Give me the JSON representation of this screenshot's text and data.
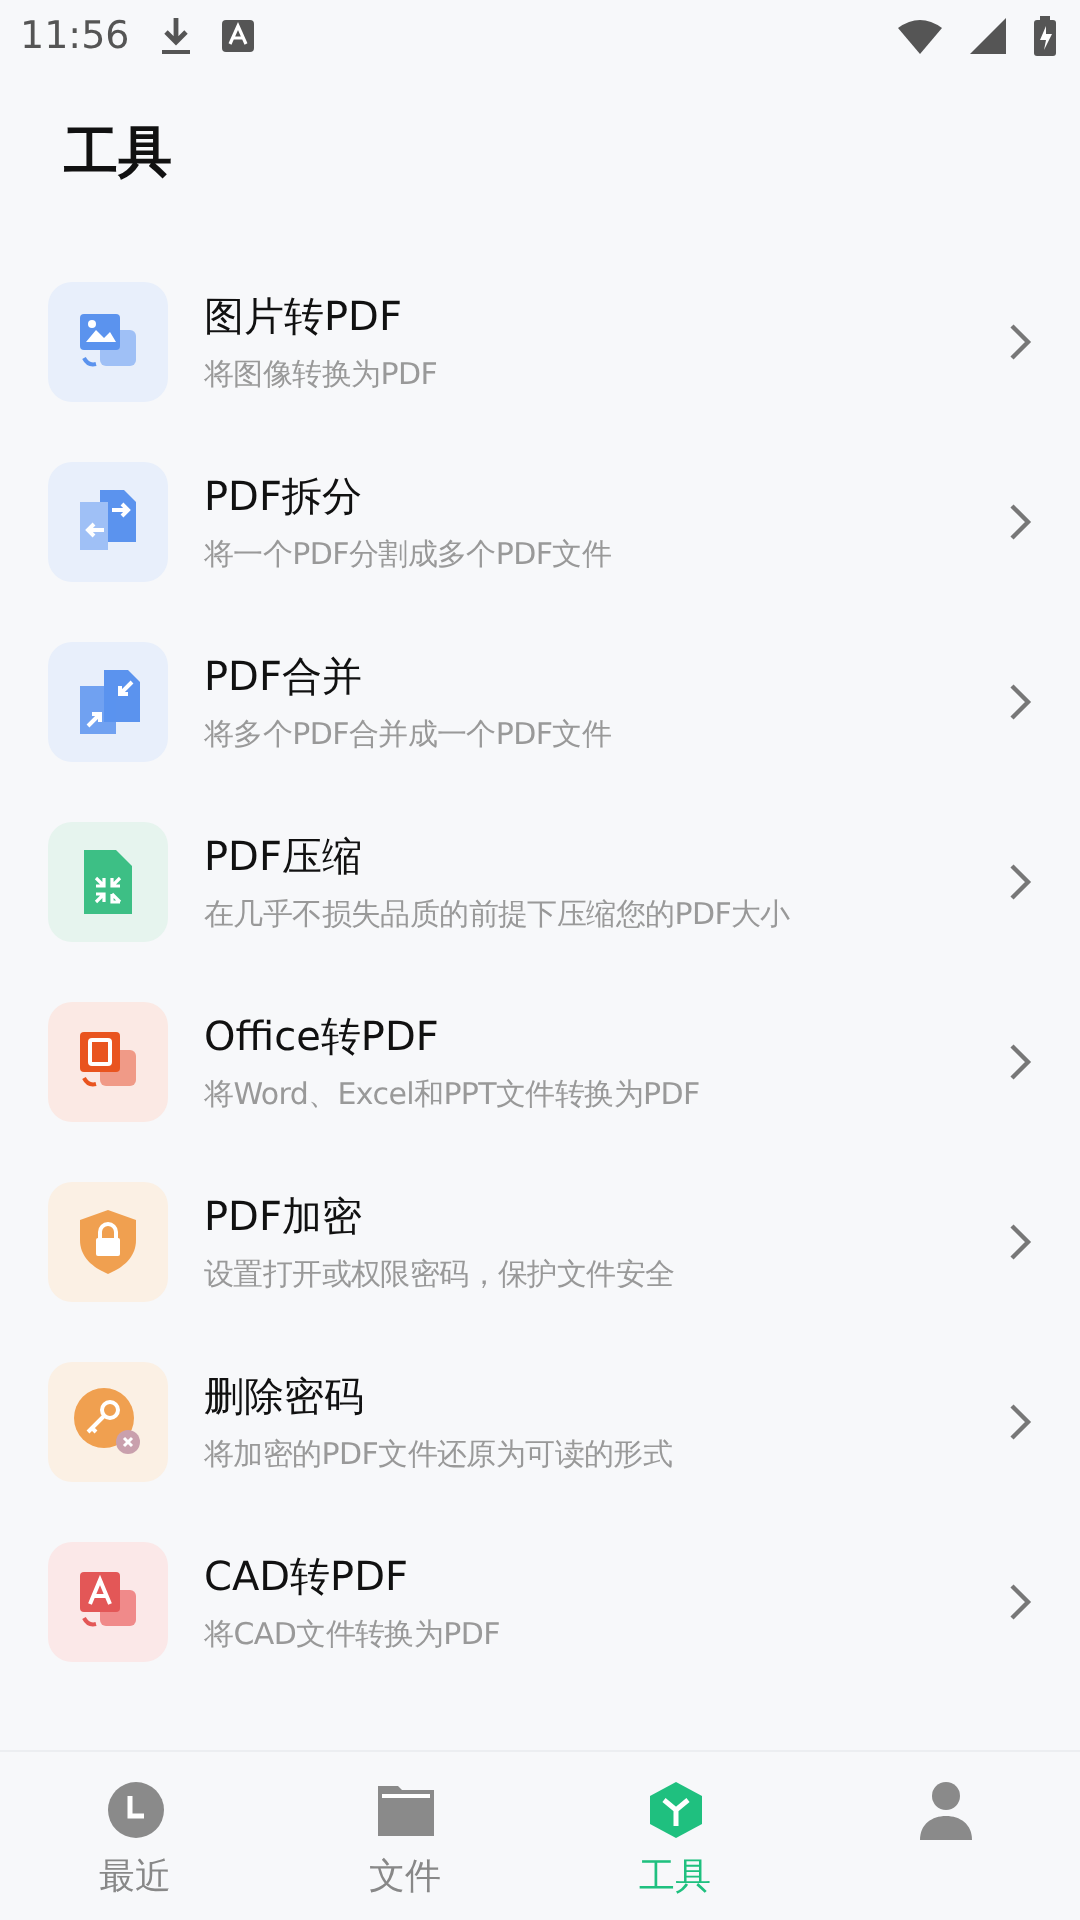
{
  "status_bar": {
    "time": "11:56"
  },
  "title": "工具",
  "tools": [
    {
      "kind": "image",
      "title": "图片转PDF",
      "subtitle": "将图像转换为PDF"
    },
    {
      "kind": "split",
      "title": "PDF拆分",
      "subtitle": "将一个PDF分割成多个PDF文件"
    },
    {
      "kind": "merge",
      "title": "PDF合并",
      "subtitle": "将多个PDF合并成一个PDF文件"
    },
    {
      "kind": "compress",
      "title": "PDF压缩",
      "subtitle": "在几乎不损失品质的前提下压缩您的PDF大小"
    },
    {
      "kind": "office",
      "title": "Office转PDF",
      "subtitle": "将Word、Excel和PPT文件转换为PDF"
    },
    {
      "kind": "lock",
      "title": "PDF加密",
      "subtitle": "设置打开或权限密码，保护文件安全"
    },
    {
      "kind": "key",
      "title": "删除密码",
      "subtitle": "将加密的PDF文件还原为可读的形式"
    },
    {
      "kind": "cad",
      "title": "CAD转PDF",
      "subtitle": "将CAD文件转换为PDF"
    }
  ],
  "nav": [
    {
      "kind": "recent",
      "label": "最近",
      "selected": false
    },
    {
      "kind": "files",
      "label": "文件",
      "selected": false
    },
    {
      "kind": "tools",
      "label": "工具",
      "selected": true
    },
    {
      "kind": "me",
      "selected": false
    }
  ]
}
